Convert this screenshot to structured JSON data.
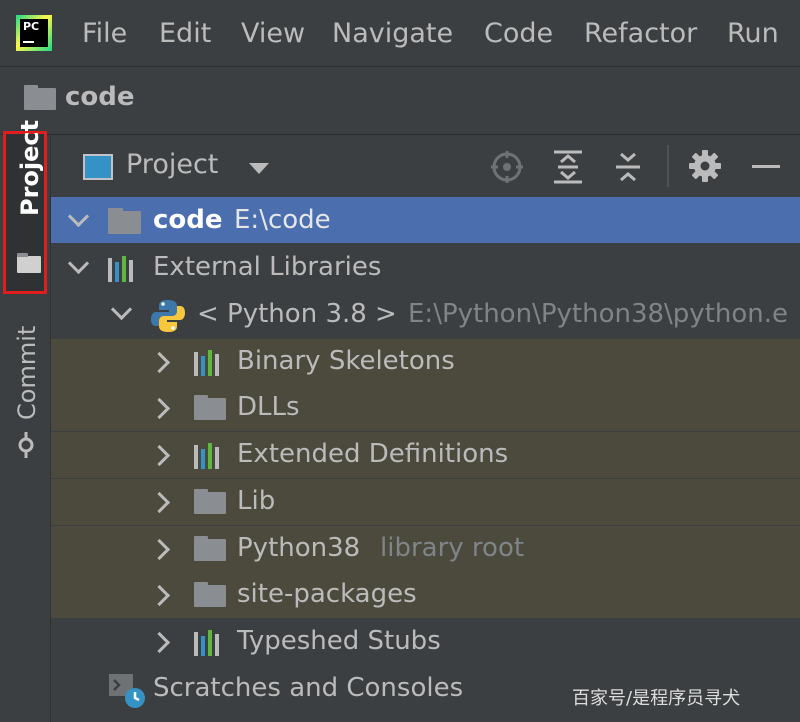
{
  "app": {
    "logo_text": "PC"
  },
  "menu": [
    "File",
    "Edit",
    "View",
    "Navigate",
    "Code",
    "Refactor",
    "Run"
  ],
  "breadcrumb": {
    "label": "code"
  },
  "toolstrip": {
    "project_label": "Project",
    "commit_label": "Commit"
  },
  "panel": {
    "title": "Project"
  },
  "tree": {
    "root": {
      "name": "code",
      "path": "E:\\code"
    },
    "external_libraries": "External Libraries",
    "python_sdk": {
      "name": "< Python 3.8 >",
      "path": "E:\\Python\\Python38\\python.e"
    },
    "items": [
      {
        "label": "Binary Skeletons",
        "icon": "library-icon"
      },
      {
        "label": "DLLs",
        "icon": "folder-icon"
      },
      {
        "label": "Extended Definitions",
        "icon": "library-icon"
      },
      {
        "label": "Lib",
        "icon": "folder-icon"
      },
      {
        "label": "Python38",
        "icon": "folder-icon",
        "note": "library root"
      },
      {
        "label": "site-packages",
        "icon": "folder-icon"
      },
      {
        "label": "Typeshed Stubs",
        "icon": "library-icon"
      }
    ],
    "scratches": "Scratches and Consoles"
  },
  "watermark": "百家号/是程序员寻犬",
  "colors": {
    "selection": "#4b6eaf",
    "library_bg": "#4b4a3d",
    "highlight_border": "#e11e1e"
  }
}
